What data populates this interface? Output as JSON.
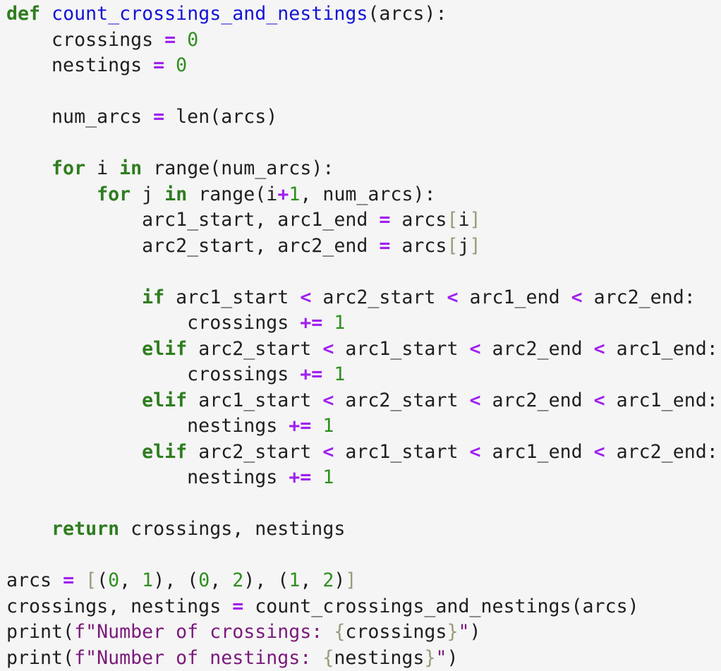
{
  "colors": {
    "background": "#f5f5f5",
    "text": "#1f1f1f",
    "keyword": "#2f7d1f",
    "function_name": "#1414d6",
    "operator": "#a020f0",
    "number": "#2f8f1f",
    "bracket": "#9a9a7a",
    "string": "#7a1a7a"
  },
  "code": {
    "language": "python",
    "lines": [
      [
        {
          "t": "kw",
          "v": "def"
        },
        {
          "t": "tx",
          "v": " "
        },
        {
          "t": "fn",
          "v": "count_crossings_and_nestings"
        },
        {
          "t": "tx",
          "v": "(arcs):"
        }
      ],
      [
        {
          "t": "tx",
          "v": "    crossings "
        },
        {
          "t": "op",
          "v": "="
        },
        {
          "t": "tx",
          "v": " "
        },
        {
          "t": "num",
          "v": "0"
        }
      ],
      [
        {
          "t": "tx",
          "v": "    nestings "
        },
        {
          "t": "op",
          "v": "="
        },
        {
          "t": "tx",
          "v": " "
        },
        {
          "t": "num",
          "v": "0"
        }
      ],
      [],
      [
        {
          "t": "tx",
          "v": "    num_arcs "
        },
        {
          "t": "op",
          "v": "="
        },
        {
          "t": "tx",
          "v": " len(arcs)"
        }
      ],
      [],
      [
        {
          "t": "tx",
          "v": "    "
        },
        {
          "t": "kw",
          "v": "for"
        },
        {
          "t": "tx",
          "v": " i "
        },
        {
          "t": "kw",
          "v": "in"
        },
        {
          "t": "tx",
          "v": " range(num_arcs):"
        }
      ],
      [
        {
          "t": "tx",
          "v": "        "
        },
        {
          "t": "kw",
          "v": "for"
        },
        {
          "t": "tx",
          "v": " j "
        },
        {
          "t": "kw",
          "v": "in"
        },
        {
          "t": "tx",
          "v": " range(i"
        },
        {
          "t": "op",
          "v": "+"
        },
        {
          "t": "num",
          "v": "1"
        },
        {
          "t": "tx",
          "v": ", num_arcs):"
        }
      ],
      [
        {
          "t": "tx",
          "v": "            arc1_start, arc1_end "
        },
        {
          "t": "op",
          "v": "="
        },
        {
          "t": "tx",
          "v": " arcs"
        },
        {
          "t": "br",
          "v": "["
        },
        {
          "t": "tx",
          "v": "i"
        },
        {
          "t": "br",
          "v": "]"
        }
      ],
      [
        {
          "t": "tx",
          "v": "            arc2_start, arc2_end "
        },
        {
          "t": "op",
          "v": "="
        },
        {
          "t": "tx",
          "v": " arcs"
        },
        {
          "t": "br",
          "v": "["
        },
        {
          "t": "tx",
          "v": "j"
        },
        {
          "t": "br",
          "v": "]"
        }
      ],
      [],
      [
        {
          "t": "tx",
          "v": "            "
        },
        {
          "t": "kw",
          "v": "if"
        },
        {
          "t": "tx",
          "v": " arc1_start "
        },
        {
          "t": "op",
          "v": "<"
        },
        {
          "t": "tx",
          "v": " arc2_start "
        },
        {
          "t": "op",
          "v": "<"
        },
        {
          "t": "tx",
          "v": " arc1_end "
        },
        {
          "t": "op",
          "v": "<"
        },
        {
          "t": "tx",
          "v": " arc2_end:"
        }
      ],
      [
        {
          "t": "tx",
          "v": "                crossings "
        },
        {
          "t": "op",
          "v": "+="
        },
        {
          "t": "tx",
          "v": " "
        },
        {
          "t": "num",
          "v": "1"
        }
      ],
      [
        {
          "t": "tx",
          "v": "            "
        },
        {
          "t": "kw",
          "v": "elif"
        },
        {
          "t": "tx",
          "v": " arc2_start "
        },
        {
          "t": "op",
          "v": "<"
        },
        {
          "t": "tx",
          "v": " arc1_start "
        },
        {
          "t": "op",
          "v": "<"
        },
        {
          "t": "tx",
          "v": " arc2_end "
        },
        {
          "t": "op",
          "v": "<"
        },
        {
          "t": "tx",
          "v": " arc1_end:"
        }
      ],
      [
        {
          "t": "tx",
          "v": "                crossings "
        },
        {
          "t": "op",
          "v": "+="
        },
        {
          "t": "tx",
          "v": " "
        },
        {
          "t": "num",
          "v": "1"
        }
      ],
      [
        {
          "t": "tx",
          "v": "            "
        },
        {
          "t": "kw",
          "v": "elif"
        },
        {
          "t": "tx",
          "v": " arc1_start "
        },
        {
          "t": "op",
          "v": "<"
        },
        {
          "t": "tx",
          "v": " arc2_start "
        },
        {
          "t": "op",
          "v": "<"
        },
        {
          "t": "tx",
          "v": " arc2_end "
        },
        {
          "t": "op",
          "v": "<"
        },
        {
          "t": "tx",
          "v": " arc1_end:"
        }
      ],
      [
        {
          "t": "tx",
          "v": "                nestings "
        },
        {
          "t": "op",
          "v": "+="
        },
        {
          "t": "tx",
          "v": " "
        },
        {
          "t": "num",
          "v": "1"
        }
      ],
      [
        {
          "t": "tx",
          "v": "            "
        },
        {
          "t": "kw",
          "v": "elif"
        },
        {
          "t": "tx",
          "v": " arc2_start "
        },
        {
          "t": "op",
          "v": "<"
        },
        {
          "t": "tx",
          "v": " arc1_start "
        },
        {
          "t": "op",
          "v": "<"
        },
        {
          "t": "tx",
          "v": " arc1_end "
        },
        {
          "t": "op",
          "v": "<"
        },
        {
          "t": "tx",
          "v": " arc2_end:"
        }
      ],
      [
        {
          "t": "tx",
          "v": "                nestings "
        },
        {
          "t": "op",
          "v": "+="
        },
        {
          "t": "tx",
          "v": " "
        },
        {
          "t": "num",
          "v": "1"
        }
      ],
      [],
      [
        {
          "t": "tx",
          "v": "    "
        },
        {
          "t": "kw",
          "v": "return"
        },
        {
          "t": "tx",
          "v": " crossings, nestings"
        }
      ],
      [],
      [
        {
          "t": "tx",
          "v": "arcs "
        },
        {
          "t": "op",
          "v": "="
        },
        {
          "t": "tx",
          "v": " "
        },
        {
          "t": "br",
          "v": "["
        },
        {
          "t": "tx",
          "v": "("
        },
        {
          "t": "num",
          "v": "0"
        },
        {
          "t": "tx",
          "v": ", "
        },
        {
          "t": "num",
          "v": "1"
        },
        {
          "t": "tx",
          "v": "), ("
        },
        {
          "t": "num",
          "v": "0"
        },
        {
          "t": "tx",
          "v": ", "
        },
        {
          "t": "num",
          "v": "2"
        },
        {
          "t": "tx",
          "v": "), ("
        },
        {
          "t": "num",
          "v": "1"
        },
        {
          "t": "tx",
          "v": ", "
        },
        {
          "t": "num",
          "v": "2"
        },
        {
          "t": "tx",
          "v": ")"
        },
        {
          "t": "br",
          "v": "]"
        }
      ],
      [
        {
          "t": "tx",
          "v": "crossings, nestings "
        },
        {
          "t": "op",
          "v": "="
        },
        {
          "t": "tx",
          "v": " count_crossings_and_nestings(arcs)"
        }
      ],
      [
        {
          "t": "tx",
          "v": "print("
        },
        {
          "t": "str",
          "v": "f\"Number of crossings: "
        },
        {
          "t": "br",
          "v": "{"
        },
        {
          "t": "tx",
          "v": "crossings"
        },
        {
          "t": "br",
          "v": "}"
        },
        {
          "t": "str",
          "v": "\""
        },
        {
          "t": "tx",
          "v": ")"
        }
      ],
      [
        {
          "t": "tx",
          "v": "print("
        },
        {
          "t": "str",
          "v": "f\"Number of nestings: "
        },
        {
          "t": "br",
          "v": "{"
        },
        {
          "t": "tx",
          "v": "nestings"
        },
        {
          "t": "br",
          "v": "}"
        },
        {
          "t": "str",
          "v": "\""
        },
        {
          "t": "tx",
          "v": ")"
        }
      ]
    ]
  }
}
